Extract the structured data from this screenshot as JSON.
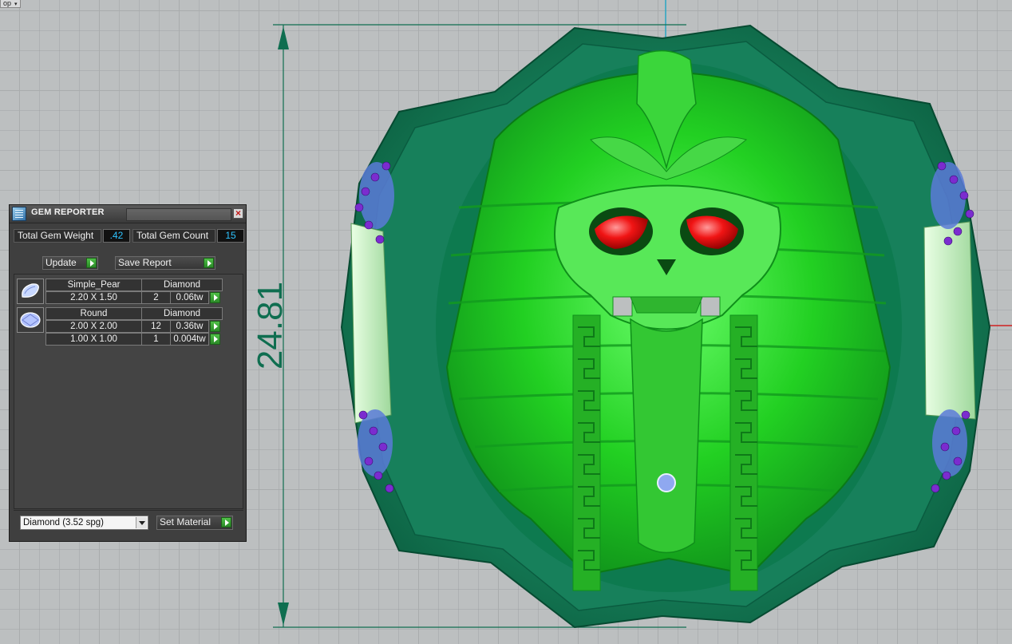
{
  "viewport": {
    "view_label": "op",
    "dimension_value": "24.81",
    "colors": {
      "grid_background": "#bcbfc0",
      "dimension_line": "#0f6e50",
      "ring_metal": "#1f8f67",
      "pharaoh_body": "#22d022",
      "eye_gems": "#e01010",
      "side_stones": "#7b2ccf"
    }
  },
  "gem_reporter": {
    "title": "GEM REPORTER",
    "total_weight_label": "Total Gem Weight",
    "total_weight_value": ".42",
    "total_count_label": "Total Gem Count",
    "total_count_value": "15",
    "update_label": "Update",
    "save_report_label": "Save Report",
    "gems": [
      {
        "shape": "Simple_Pear",
        "material": "Diamond",
        "icon": "pear-gem-icon",
        "sizes": [
          {
            "size": "2.20 X 1.50",
            "count": "2",
            "weight": "0.06tw"
          }
        ]
      },
      {
        "shape": "Round",
        "material": "Diamond",
        "icon": "round-gem-icon",
        "sizes": [
          {
            "size": "2.00 X 2.00",
            "count": "12",
            "weight": "0.36tw"
          },
          {
            "size": "1.00 X 1.00",
            "count": "1",
            "weight": "0.004tw"
          }
        ]
      }
    ],
    "material_select_value": "Diamond     (3.52 spg)",
    "set_material_label": "Set Material"
  }
}
